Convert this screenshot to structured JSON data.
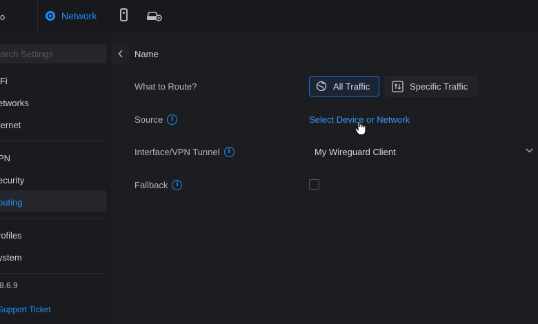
{
  "topbar": {
    "logo_fragment": "o",
    "tab_network_label": "Network",
    "icons": [
      "network-icon",
      "device-icon",
      "gateway-settings-icon"
    ]
  },
  "sidebar": {
    "search_placeholder": "earch Settings",
    "items": [
      {
        "label": "iFi",
        "active": false
      },
      {
        "label": "etworks",
        "active": false
      },
      {
        "label": "ternet",
        "active": false
      },
      {
        "label": "PN",
        "active": false
      },
      {
        "label": "ecurity",
        "active": false
      },
      {
        "label": "outing",
        "active": true
      },
      {
        "label": "rofiles",
        "active": false
      },
      {
        "label": "ystem",
        "active": false
      }
    ],
    "version": "8.6.9",
    "support_link": "Support Ticket"
  },
  "form": {
    "name_label": "Name",
    "route_label": "What to Route?",
    "route_options": [
      "All Traffic",
      "Specific Traffic"
    ],
    "route_selected": "All Traffic",
    "source_label": "Source",
    "source_link": "Select Device or Network",
    "interface_label": "Interface/VPN Tunnel",
    "interface_value": "My Wireguard Client",
    "fallback_label": "Fallback",
    "fallback_checked": false
  },
  "colors": {
    "accent": "#1e8fff",
    "background": "#1c1d21",
    "sidebar": "#1a1b1f"
  }
}
